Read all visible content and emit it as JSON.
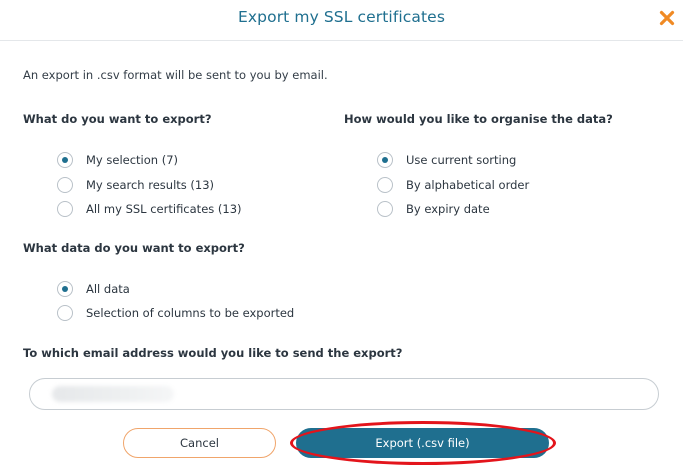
{
  "dialog": {
    "title": "Export my SSL certificates",
    "close_icon": "close-icon",
    "intro": "An export in .csv format will be sent to you by email."
  },
  "export_what": {
    "question": "What do you want to export?",
    "options": [
      {
        "label": "My selection (7)",
        "checked": true
      },
      {
        "label": "My search results (13)",
        "checked": false
      },
      {
        "label": "All my SSL certificates (13)",
        "checked": false
      }
    ]
  },
  "organise": {
    "question": "How would you like to organise the data?",
    "options": [
      {
        "label": "Use current sorting",
        "checked": true
      },
      {
        "label": "By alphabetical order",
        "checked": false
      },
      {
        "label": "By expiry date",
        "checked": false
      }
    ]
  },
  "data_export": {
    "question": "What data do you want to export?",
    "options": [
      {
        "label": "All data",
        "checked": true
      },
      {
        "label": "Selection of columns to be exported",
        "checked": false
      }
    ]
  },
  "email": {
    "question": "To which email address would you like to send the export?",
    "value": ""
  },
  "buttons": {
    "cancel": "Cancel",
    "export": "Export (.csv file)"
  },
  "colors": {
    "accent": "#1f6f8f",
    "close_orange": "#f08a24",
    "cancel_border": "#f0a56b",
    "annotation": "#e3141b"
  }
}
